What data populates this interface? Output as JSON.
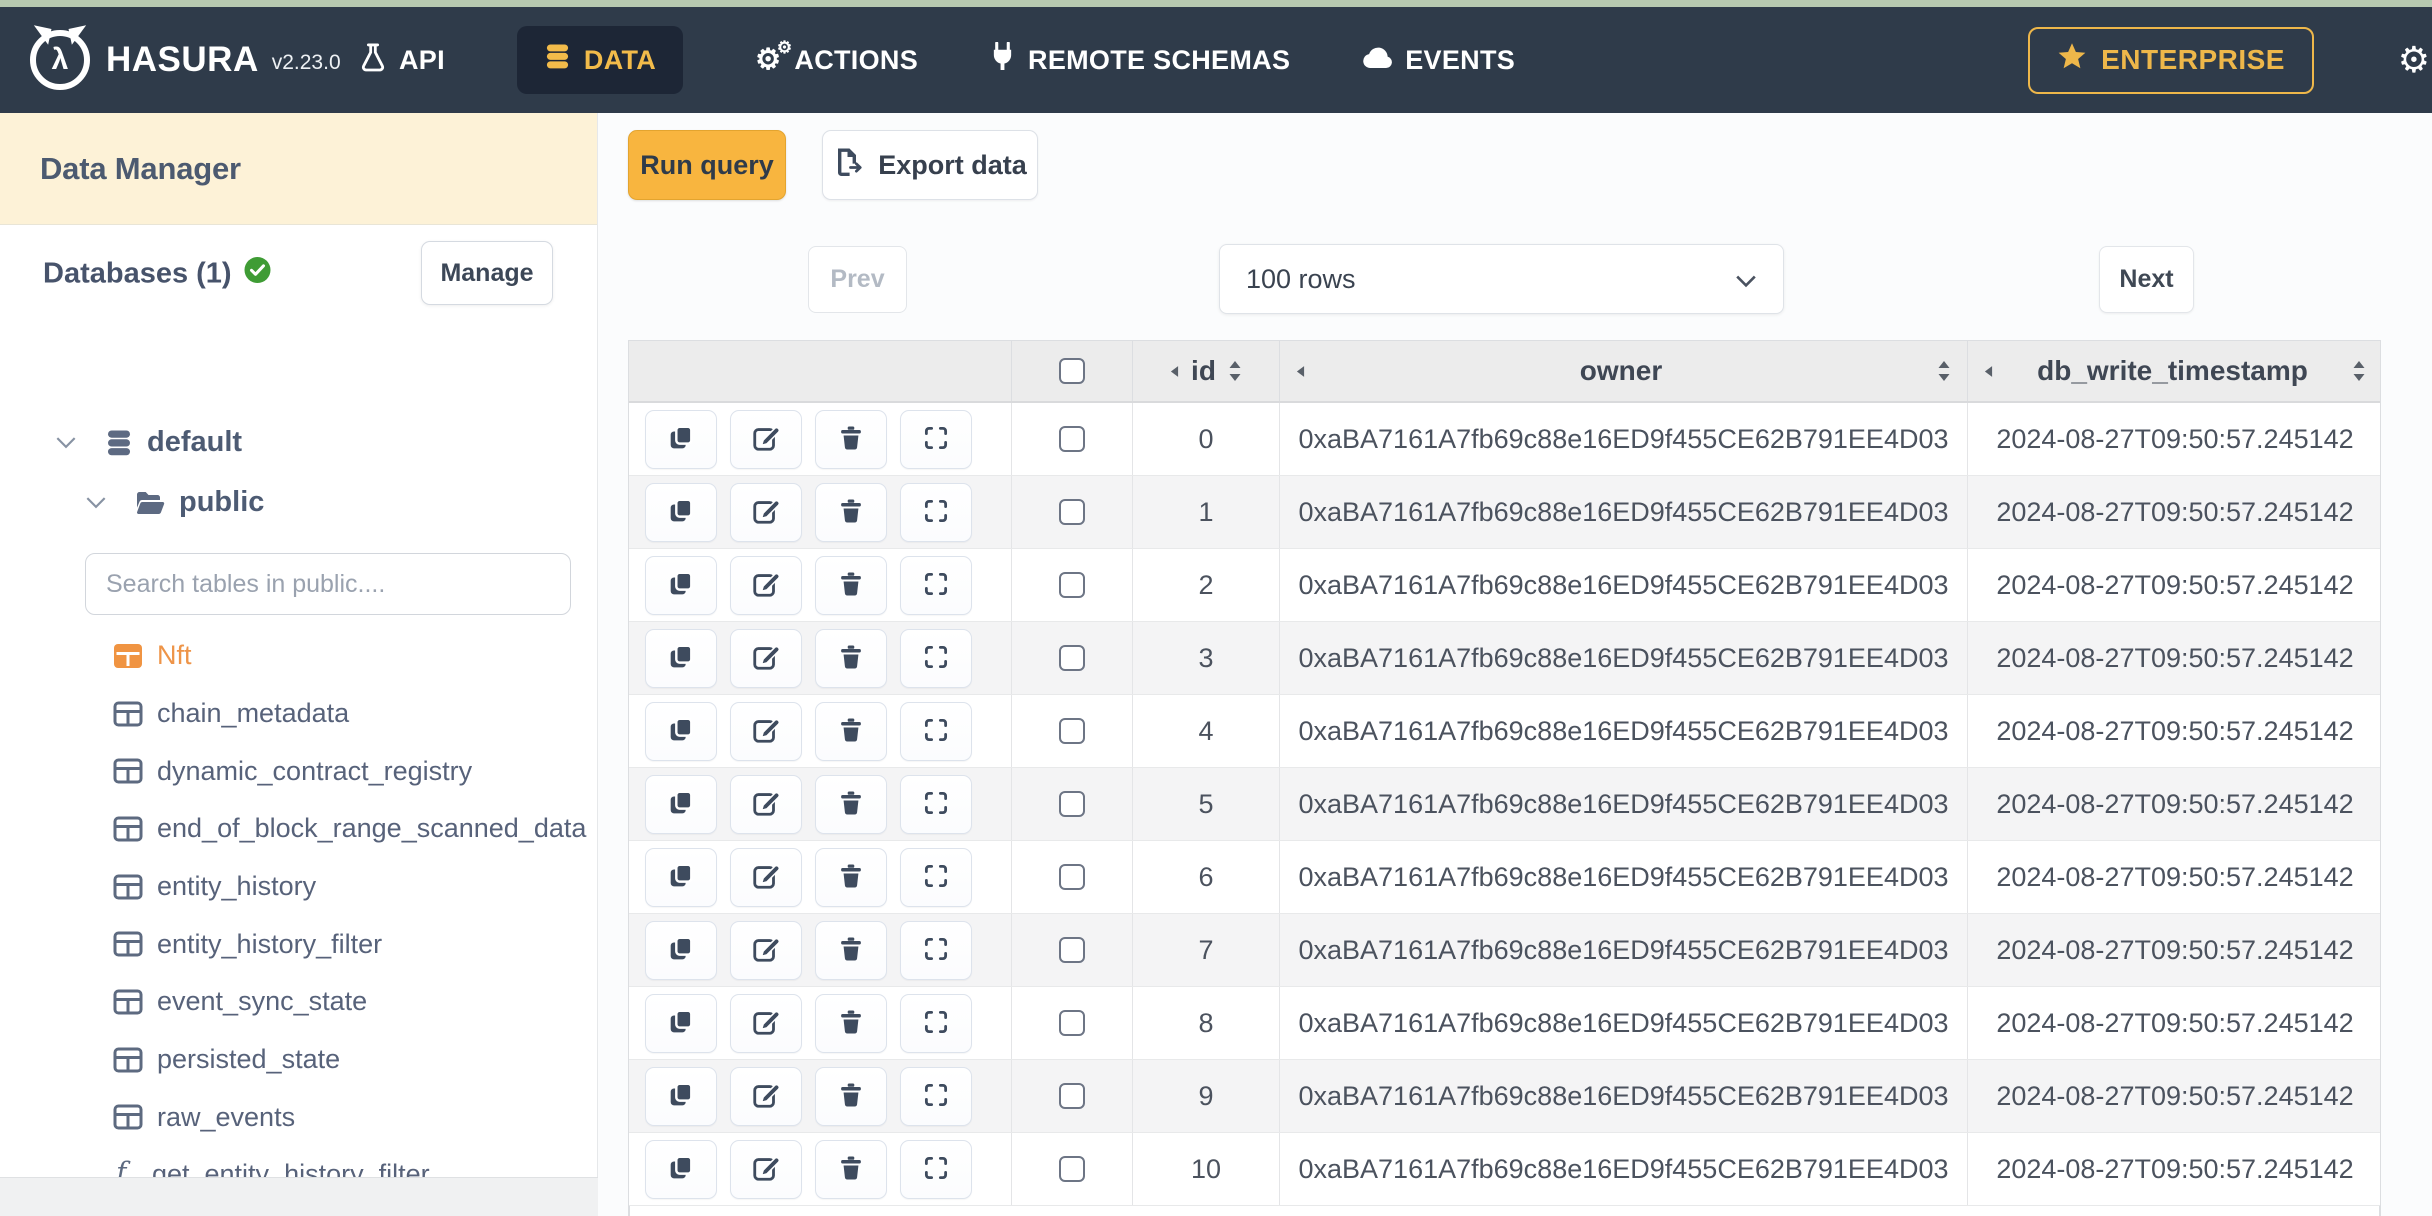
{
  "topbar": {
    "brand": "HASURA",
    "version": "v2.23.0",
    "nav": [
      "API",
      "DATA",
      "ACTIONS",
      "REMOTE SCHEMAS",
      "EVENTS"
    ],
    "active_nav": "DATA",
    "enterprise_label": "ENTERPRISE"
  },
  "sidebar": {
    "title": "Data Manager",
    "databases_label": "Databases (1)",
    "manage_label": "Manage",
    "database_node": "default",
    "schema_node": "public",
    "search_placeholder": "Search tables in public....",
    "active_table": "Nft",
    "tables": [
      "Nft",
      "chain_metadata",
      "dynamic_contract_registry",
      "end_of_block_range_scanned_data",
      "entity_history",
      "entity_history_filter",
      "event_sync_state",
      "persisted_state",
      "raw_events"
    ],
    "function_name": "get_entity_history_filter"
  },
  "toolbar": {
    "run_query_label": "Run query",
    "export_data_label": "Export data"
  },
  "pagination": {
    "prev_label": "Prev",
    "rows_value": "100 rows",
    "next_label": "Next"
  },
  "table": {
    "columns": [
      "id",
      "owner",
      "db_write_timestamp"
    ],
    "rows": [
      {
        "id": "0",
        "owner": "0xaBA7161A7fb69c88e16ED9f455CE62B791EE4D03",
        "db_write_timestamp": "2024-08-27T09:50:57.245142"
      },
      {
        "id": "1",
        "owner": "0xaBA7161A7fb69c88e16ED9f455CE62B791EE4D03",
        "db_write_timestamp": "2024-08-27T09:50:57.245142"
      },
      {
        "id": "2",
        "owner": "0xaBA7161A7fb69c88e16ED9f455CE62B791EE4D03",
        "db_write_timestamp": "2024-08-27T09:50:57.245142"
      },
      {
        "id": "3",
        "owner": "0xaBA7161A7fb69c88e16ED9f455CE62B791EE4D03",
        "db_write_timestamp": "2024-08-27T09:50:57.245142"
      },
      {
        "id": "4",
        "owner": "0xaBA7161A7fb69c88e16ED9f455CE62B791EE4D03",
        "db_write_timestamp": "2024-08-27T09:50:57.245142"
      },
      {
        "id": "5",
        "owner": "0xaBA7161A7fb69c88e16ED9f455CE62B791EE4D03",
        "db_write_timestamp": "2024-08-27T09:50:57.245142"
      },
      {
        "id": "6",
        "owner": "0xaBA7161A7fb69c88e16ED9f455CE62B791EE4D03",
        "db_write_timestamp": "2024-08-27T09:50:57.245142"
      },
      {
        "id": "7",
        "owner": "0xaBA7161A7fb69c88e16ED9f455CE62B791EE4D03",
        "db_write_timestamp": "2024-08-27T09:50:57.245142"
      },
      {
        "id": "8",
        "owner": "0xaBA7161A7fb69c88e16ED9f455CE62B791EE4D03",
        "db_write_timestamp": "2024-08-27T09:50:57.245142"
      },
      {
        "id": "9",
        "owner": "0xaBA7161A7fb69c88e16ED9f455CE62B791EE4D03",
        "db_write_timestamp": "2024-08-27T09:50:57.245142"
      },
      {
        "id": "10",
        "owner": "0xaBA7161A7fb69c88e16ED9f455CE62B791EE4D03",
        "db_write_timestamp": "2024-08-27T09:50:57.245142"
      }
    ]
  },
  "icons": {
    "brand": "hasura-logo",
    "api": "flask-icon",
    "data": "database-icon",
    "actions": "gears-icon",
    "remote_schemas": "plug-icon",
    "events": "cloud-icon",
    "enterprise": "star-icon",
    "settings": "gear-icon",
    "databases_status": "check-circle-icon",
    "tree_toggle": "chevron-down-icon",
    "schema": "folder-open-icon",
    "table_item": "table-grid-icon",
    "function_item": "fx-icon",
    "row_actions": [
      "copy-icon",
      "edit-icon",
      "trash-icon",
      "expand-icon"
    ],
    "sort": "sort-arrows-icon",
    "collapse_column": "caret-left-icon",
    "export": "file-export-icon"
  },
  "colors": {
    "navbar_bg": "#2f3b4a",
    "navbar_active_bg": "#1d2636",
    "gold": "#f2bb4a",
    "run_query_bg": "#f8b53f",
    "sidebar_header_bg": "#fdf2d7",
    "active_table_orange": "#ee9448",
    "status_green": "#3f9c35",
    "table_header_bg": "#ececec",
    "row_stripe": "#f4f4f5",
    "top_strip": "#b7c9b0"
  }
}
